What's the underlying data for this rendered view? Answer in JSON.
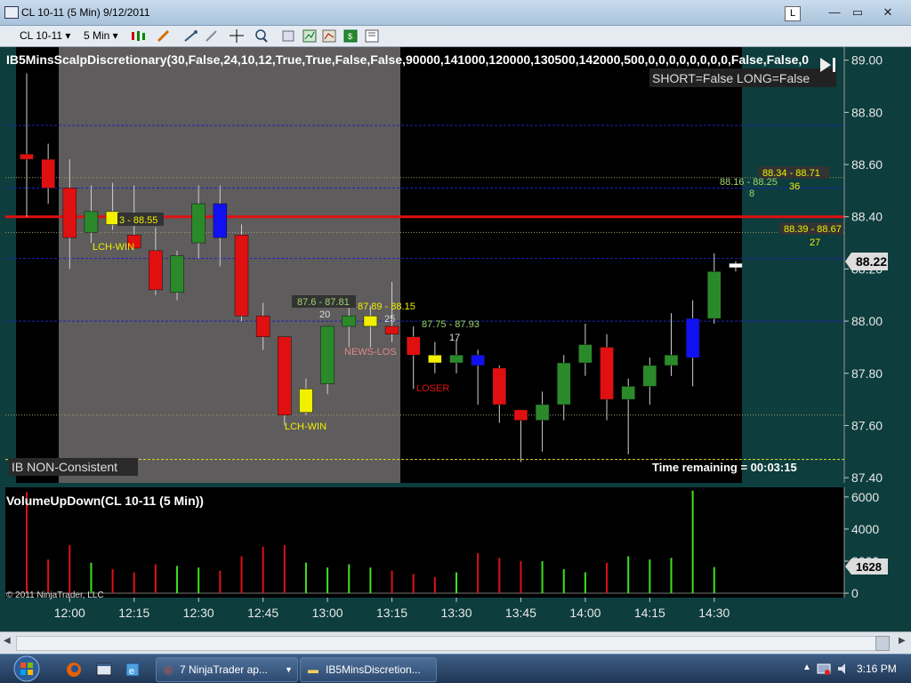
{
  "window": {
    "title": "CL 10-11 (5 Min)  9/12/2011",
    "lock_label": "L",
    "minimize": "—",
    "maximize": "▭",
    "close": "✕"
  },
  "toolbar": {
    "instrument": "CL 10-11",
    "interval": "5 Min"
  },
  "price_panel": {
    "indicator_label": "IB5MinsScalpDiscretionary(30,False,24,10,12,True,True,False,False,90000,141000,120000,130500,142000,500,0,0,0,0,0,0,0,0,False,False,0",
    "status_text": "SHORT=False LONG=False",
    "ib_label": "IB NON-Consistent",
    "time_remaining": "Time remaining = 00:03:15",
    "price_tag": "88.22",
    "y_ticks": [
      "89.00",
      "88.80",
      "88.60",
      "88.40",
      "88.20",
      "88.00",
      "87.80",
      "87.60",
      "87.40"
    ],
    "annotations": {
      "a1": "3 - 88.55",
      "a2": "LCH-WIN",
      "a3": "87.6 - 87.81",
      "a4": "20",
      "a5": "87.89 - 88.15",
      "a6": "25",
      "a7": "NEWS-LOS",
      "a8": "LCH-WIN",
      "a9": "87.75 - 87.93",
      "a10": "17",
      "a11": "LOSER",
      "a12": "88.34 - 88.71",
      "a13": "36",
      "a14": "88.16 - 88.25",
      "a15": "8",
      "a16": "88.39 - 88.67",
      "a17": "27"
    }
  },
  "volume_panel": {
    "title": "VolumeUpDown(CL 10-11 (5 Min))",
    "y_ticks": [
      "6000",
      "4000",
      "2000",
      "0"
    ],
    "last_tag": "1628",
    "copyright": "© 2011 NinjaTrader, LLC"
  },
  "x_ticks": [
    "12:00",
    "12:15",
    "12:30",
    "12:45",
    "13:00",
    "13:15",
    "13:30",
    "13:45",
    "14:00",
    "14:15",
    "14:30"
  ],
  "colors": {
    "up": "#2a8a2a",
    "down": "#e01010",
    "neutral": "#f0f000",
    "blue": "#1010f0",
    "shade": "#5e5c5c"
  },
  "chart_data": {
    "type": "candlestick",
    "candles": [
      {
        "o": 88.64,
        "h": 88.95,
        "l": 88.4,
        "c": 88.62,
        "color": "red"
      },
      {
        "o": 88.62,
        "h": 88.68,
        "l": 88.45,
        "c": 88.51,
        "color": "red"
      },
      {
        "o": 88.51,
        "h": 88.62,
        "l": 88.2,
        "c": 88.32,
        "color": "red"
      },
      {
        "o": 88.34,
        "h": 88.52,
        "l": 88.3,
        "c": 88.42,
        "color": "green"
      },
      {
        "o": 88.42,
        "h": 88.53,
        "l": 88.35,
        "c": 88.37,
        "color": "yellow"
      },
      {
        "o": 88.33,
        "h": 88.52,
        "l": 88.28,
        "c": 88.28,
        "color": "red"
      },
      {
        "o": 88.27,
        "h": 88.36,
        "l": 88.1,
        "c": 88.12,
        "color": "red"
      },
      {
        "o": 88.11,
        "h": 88.27,
        "l": 88.08,
        "c": 88.25,
        "color": "green"
      },
      {
        "o": 88.3,
        "h": 88.52,
        "l": 88.24,
        "c": 88.45,
        "color": "green"
      },
      {
        "o": 88.45,
        "h": 88.52,
        "l": 88.21,
        "c": 88.32,
        "color": "blue"
      },
      {
        "o": 88.33,
        "h": 88.37,
        "l": 88.0,
        "c": 88.02,
        "color": "red"
      },
      {
        "o": 88.02,
        "h": 88.07,
        "l": 87.89,
        "c": 87.94,
        "color": "red"
      },
      {
        "o": 87.94,
        "h": 87.94,
        "l": 87.6,
        "c": 87.64,
        "color": "red"
      },
      {
        "o": 87.74,
        "h": 87.78,
        "l": 87.64,
        "c": 87.65,
        "color": "yellow"
      },
      {
        "o": 87.76,
        "h": 87.98,
        "l": 87.72,
        "c": 87.98,
        "color": "green"
      },
      {
        "o": 87.98,
        "h": 88.05,
        "l": 87.9,
        "c": 88.02,
        "color": "green"
      },
      {
        "o": 88.02,
        "h": 88.06,
        "l": 87.9,
        "c": 87.98,
        "color": "yellow"
      },
      {
        "o": 87.98,
        "h": 88.15,
        "l": 87.92,
        "c": 87.95,
        "color": "red"
      },
      {
        "o": 87.94,
        "h": 87.98,
        "l": 87.74,
        "c": 87.87,
        "color": "red"
      },
      {
        "o": 87.87,
        "h": 87.92,
        "l": 87.8,
        "c": 87.84,
        "color": "yellow"
      },
      {
        "o": 87.84,
        "h": 87.93,
        "l": 87.8,
        "c": 87.87,
        "color": "green"
      },
      {
        "o": 87.83,
        "h": 87.89,
        "l": 87.68,
        "c": 87.87,
        "color": "blue"
      },
      {
        "o": 87.82,
        "h": 87.83,
        "l": 87.61,
        "c": 87.68,
        "color": "red"
      },
      {
        "o": 87.66,
        "h": 87.66,
        "l": 87.46,
        "c": 87.62,
        "color": "red"
      },
      {
        "o": 87.62,
        "h": 87.73,
        "l": 87.5,
        "c": 87.68,
        "color": "green"
      },
      {
        "o": 87.68,
        "h": 87.87,
        "l": 87.62,
        "c": 87.84,
        "color": "green"
      },
      {
        "o": 87.84,
        "h": 87.99,
        "l": 87.79,
        "c": 87.91,
        "color": "green"
      },
      {
        "o": 87.9,
        "h": 87.95,
        "l": 87.62,
        "c": 87.7,
        "color": "red"
      },
      {
        "o": 87.7,
        "h": 87.78,
        "l": 87.49,
        "c": 87.75,
        "color": "green"
      },
      {
        "o": 87.75,
        "h": 87.86,
        "l": 87.68,
        "c": 87.83,
        "color": "green"
      },
      {
        "o": 87.83,
        "h": 88.03,
        "l": 87.79,
        "c": 87.87,
        "color": "green"
      },
      {
        "o": 87.86,
        "h": 88.08,
        "l": 87.75,
        "c": 88.01,
        "color": "blue"
      },
      {
        "o": 88.01,
        "h": 88.26,
        "l": 87.99,
        "c": 88.19,
        "color": "green"
      },
      {
        "o": 88.21,
        "h": 88.23,
        "l": 88.19,
        "c": 88.22,
        "color": "white"
      }
    ],
    "volume": [
      {
        "v": 6300,
        "color": "red"
      },
      {
        "v": 2100,
        "color": "red"
      },
      {
        "v": 3000,
        "color": "red"
      },
      {
        "v": 1900,
        "color": "green"
      },
      {
        "v": 1500,
        "color": "red"
      },
      {
        "v": 1300,
        "color": "red"
      },
      {
        "v": 1800,
        "color": "red"
      },
      {
        "v": 1700,
        "color": "green"
      },
      {
        "v": 1600,
        "color": "green"
      },
      {
        "v": 1400,
        "color": "red"
      },
      {
        "v": 2300,
        "color": "red"
      },
      {
        "v": 2900,
        "color": "red"
      },
      {
        "v": 3000,
        "color": "red"
      },
      {
        "v": 1900,
        "color": "green"
      },
      {
        "v": 1600,
        "color": "green"
      },
      {
        "v": 1800,
        "color": "green"
      },
      {
        "v": 1600,
        "color": "green"
      },
      {
        "v": 1400,
        "color": "red"
      },
      {
        "v": 1200,
        "color": "red"
      },
      {
        "v": 1000,
        "color": "red"
      },
      {
        "v": 1300,
        "color": "green"
      },
      {
        "v": 2500,
        "color": "red"
      },
      {
        "v": 2200,
        "color": "red"
      },
      {
        "v": 2000,
        "color": "red"
      },
      {
        "v": 2000,
        "color": "green"
      },
      {
        "v": 1500,
        "color": "green"
      },
      {
        "v": 1300,
        "color": "green"
      },
      {
        "v": 1900,
        "color": "red"
      },
      {
        "v": 2300,
        "color": "green"
      },
      {
        "v": 2100,
        "color": "green"
      },
      {
        "v": 2200,
        "color": "green"
      },
      {
        "v": 6400,
        "color": "green"
      },
      {
        "v": 1628,
        "color": "green"
      }
    ],
    "ylim": [
      87.38,
      89.05
    ],
    "volume_ylim": [
      0,
      6600
    ],
    "horizontal_lines": [
      {
        "price": 88.4,
        "color": "#e01010",
        "style": "solid"
      },
      {
        "price": 88.75,
        "color": "#2020c0",
        "style": "dashed"
      },
      {
        "price": 88.51,
        "color": "#2020c0",
        "style": "dashed"
      },
      {
        "price": 88.24,
        "color": "#2020c0",
        "style": "dashed"
      },
      {
        "price": 88.0,
        "color": "#2020c0",
        "style": "dashed"
      },
      {
        "price": 88.55,
        "color": "#a0a070",
        "style": "dotted"
      },
      {
        "price": 88.34,
        "color": "#a0a070",
        "style": "dotted"
      },
      {
        "price": 87.64,
        "color": "#a0a070",
        "style": "dotted"
      },
      {
        "price": 87.47,
        "color": "#e0e020",
        "style": "dashed"
      }
    ]
  },
  "taskbar": {
    "btn1": "7 NinjaTrader ap...",
    "btn2": "IB5MinsDiscretion...",
    "clock": "3:16 PM"
  }
}
